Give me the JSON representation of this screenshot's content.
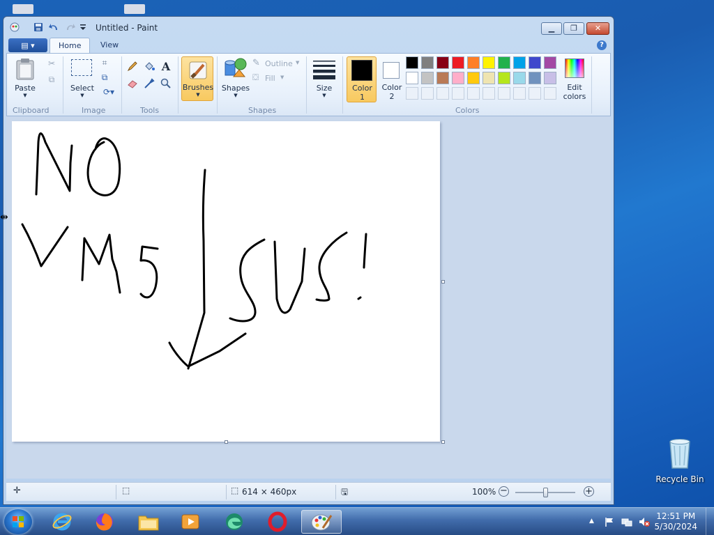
{
  "window": {
    "title": "Untitled - Paint"
  },
  "ribbon": {
    "tabs": [
      "Home",
      "View"
    ],
    "clipboard": {
      "paste": "Paste",
      "label": "Clipboard"
    },
    "image": {
      "select": "Select",
      "label": "Image"
    },
    "tools": {
      "label": "Tools"
    },
    "brushes": "Brushes",
    "shapes": {
      "shapes": "Shapes",
      "outline": "Outline",
      "fill": "Fill",
      "label": "Shapes"
    },
    "size": "Size",
    "color1": {
      "line1": "Color",
      "line2": "1"
    },
    "color2": {
      "line1": "Color",
      "line2": "2"
    },
    "colors": {
      "label": "Colors",
      "edit_line1": "Edit",
      "edit_line2": "colors",
      "row1": [
        "#000000",
        "#7f7f7f",
        "#880015",
        "#ed1c24",
        "#ff7f27",
        "#fff200",
        "#22b14c",
        "#00a2e8",
        "#3f48cc",
        "#a349a4"
      ],
      "row2": [
        "#ffffff",
        "#c3c3c3",
        "#b97a57",
        "#ffaec9",
        "#ffc90e",
        "#efe4b0",
        "#b5e61d",
        "#99d9ea",
        "#7092be",
        "#c8bfe7"
      ]
    }
  },
  "canvas": {
    "drawing_text": "NO VMS SUS!"
  },
  "statusbar": {
    "dimensions": "614 × 460px",
    "zoom": "100%"
  },
  "desktop": {
    "recycle_bin": "Recycle Bin"
  },
  "taskbar": {
    "time": "12:51 PM",
    "date": "5/30/2024"
  }
}
